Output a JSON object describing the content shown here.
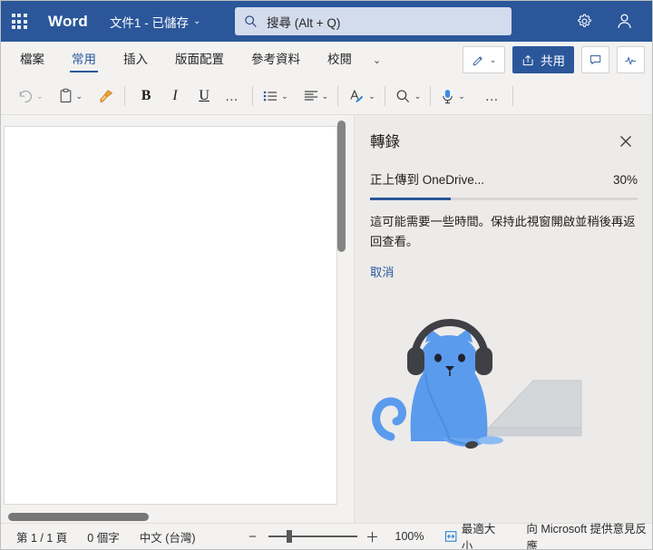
{
  "titlebar": {
    "app_launcher": "app-launcher",
    "app_name": "Word",
    "doc_title": "文件1 - 已儲存",
    "doc_title_chevron": "⌄",
    "search_placeholder": "搜尋 (Alt + Q)",
    "settings_label": "設定",
    "account_label": "帳戶"
  },
  "ribbon": {
    "tabs": [
      {
        "label": "檔案",
        "active": false
      },
      {
        "label": "常用",
        "active": true
      },
      {
        "label": "插入",
        "active": false
      },
      {
        "label": "版面配置",
        "active": false
      },
      {
        "label": "參考資料",
        "active": false
      },
      {
        "label": "校閱",
        "active": false
      }
    ],
    "more_tabs_chevron": "⌄",
    "pen_chevron": "⌄",
    "share_label": "共用",
    "comments_label": "註解",
    "activity_label": "活動"
  },
  "toolbar": {
    "undo_chevron": "⌄",
    "paste_chevron": "⌄",
    "format_painter_label": "複製格式",
    "bold_label": "B",
    "italic_label": "I",
    "underline_label": "U",
    "font_more_label": "…",
    "bullets_chevron": "⌄",
    "align_chevron": "⌄",
    "styles_chevron": "⌄",
    "find_chevron": "⌄",
    "dictate_chevron": "⌄",
    "toolbar_more_label": "…"
  },
  "pane": {
    "title": "轉錄",
    "close_label": "✕",
    "status_text": "正上傳到 OneDrive...",
    "progress_percent": "30%",
    "progress_value": 30,
    "description": "這可能需要一些時間。保持此視窗開啟並稍後再返回查看。",
    "cancel_label": "取消",
    "illustration": "cat-with-headphones-and-laptop"
  },
  "statusbar": {
    "page_info": "第 1 / 1 頁",
    "word_count": "0 個字",
    "language": "中文 (台灣)",
    "zoom_minus": "−",
    "zoom_plus": "＋",
    "zoom_level": "100%",
    "fit_width_label": "最適大小",
    "feedback_label": "向 Microsoft 提供意見反應"
  },
  "colors": {
    "brand_blue": "#2b579a",
    "ribbon_bg": "#f3f2f1",
    "pane_bg": "#edebe9",
    "cat_blue": "#5b9bed",
    "headphone_gray": "#4a4a4a"
  }
}
